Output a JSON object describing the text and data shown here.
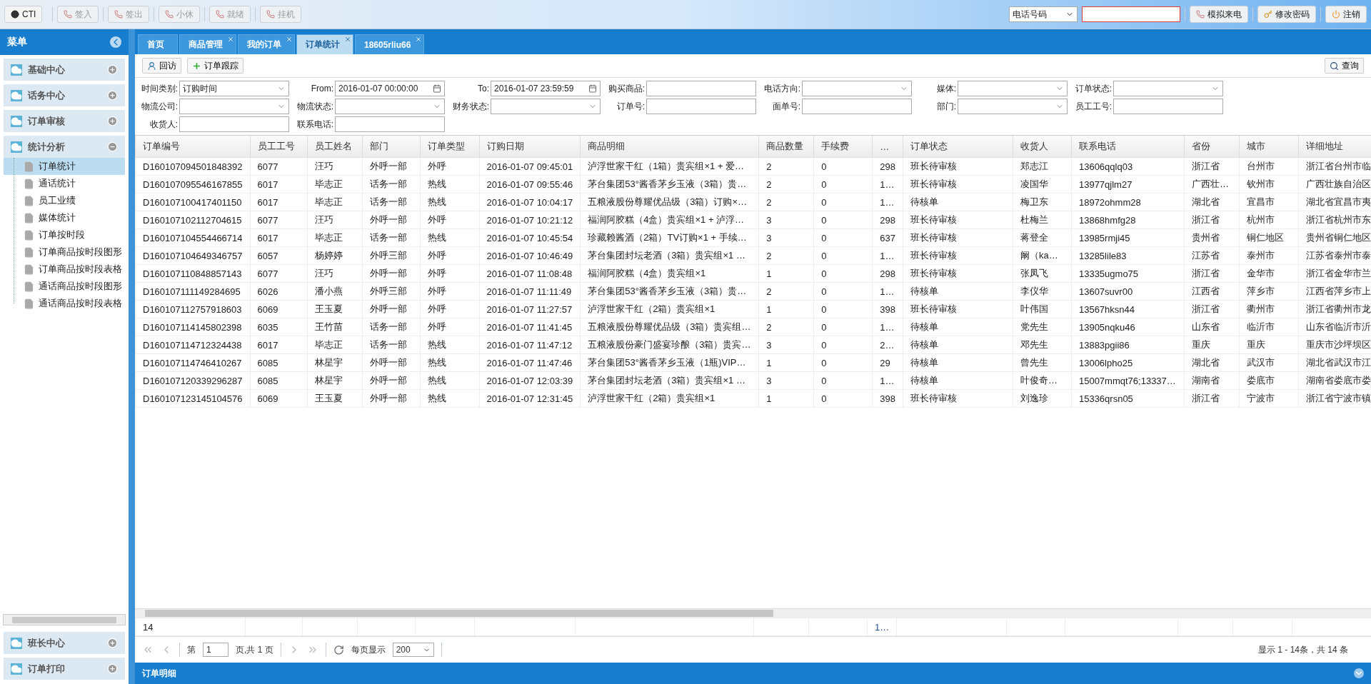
{
  "toolbar": {
    "left_buttons": [
      {
        "label": "CTI",
        "kind": "cti",
        "disabled": false
      },
      {
        "label": "签入",
        "kind": "phone",
        "disabled": true
      },
      {
        "label": "签出",
        "kind": "phone",
        "disabled": true
      },
      {
        "label": "小休",
        "kind": "phone",
        "disabled": true
      },
      {
        "label": "就绪",
        "kind": "phone",
        "disabled": true
      },
      {
        "label": "挂机",
        "kind": "phone",
        "disabled": true
      }
    ],
    "phone_select": {
      "value": "电话号码"
    },
    "right_buttons": [
      {
        "label": "模拟来电",
        "kind": "phone"
      },
      {
        "label": "修改密码",
        "kind": "key"
      },
      {
        "label": "注销",
        "kind": "power"
      }
    ]
  },
  "sidebar": {
    "title": "菜单",
    "sections": [
      {
        "label": "基础中心",
        "expanded": false
      },
      {
        "label": "话务中心",
        "expanded": false
      },
      {
        "label": "订单审核",
        "expanded": false
      },
      {
        "label": "统计分析",
        "expanded": true,
        "children": [
          {
            "label": "订单统计",
            "selected": true
          },
          {
            "label": "通话统计",
            "selected": false
          },
          {
            "label": "员工业绩",
            "selected": false
          },
          {
            "label": "媒体统计",
            "selected": false
          },
          {
            "label": "订单按时段",
            "selected": false
          },
          {
            "label": "订单商品按时段图形",
            "selected": false
          },
          {
            "label": "订单商品按时段表格",
            "selected": false
          },
          {
            "label": "通话商品按时段图形",
            "selected": false
          },
          {
            "label": "通话商品按时段表格",
            "selected": false
          }
        ]
      }
    ],
    "bottom_sections": [
      {
        "label": "班长中心",
        "expanded": false
      },
      {
        "label": "订单打印",
        "expanded": false
      }
    ]
  },
  "tabs": [
    {
      "label": "首页",
      "selected": false,
      "closable": false
    },
    {
      "label": "商品管理",
      "selected": false,
      "closable": true
    },
    {
      "label": "我的订单",
      "selected": false,
      "closable": true
    },
    {
      "label": "订单统计",
      "selected": true,
      "closable": true
    },
    {
      "label": "18605rliu66",
      "selected": false,
      "closable": true
    }
  ],
  "actions": [
    {
      "label": "回访",
      "kind": "user"
    },
    {
      "label": "订单跟踪",
      "kind": "add"
    }
  ],
  "query_button": "查询",
  "filters": [
    [
      {
        "label": "时间类别:",
        "kind": "select",
        "value": "订购时间"
      },
      {
        "label": "From:",
        "kind": "date",
        "value": "2016-01-07 00:00:00"
      },
      {
        "label": "To:",
        "kind": "date",
        "value": "2016-01-07 23:59:59"
      },
      {
        "label": "购买商品:",
        "kind": "input"
      },
      {
        "label": "电话方向:",
        "kind": "select"
      },
      {
        "label": "媒体:",
        "kind": "select"
      },
      {
        "label": "订单状态:",
        "kind": "select"
      }
    ],
    [
      {
        "label": "物流公司:",
        "kind": "select"
      },
      {
        "label": "物流状态:",
        "kind": "select"
      },
      {
        "label": "财务状态:",
        "kind": "select"
      },
      {
        "label": "订单号:",
        "kind": "input"
      },
      {
        "label": "面单号:",
        "kind": "input"
      },
      {
        "label": "部门:",
        "kind": "select"
      },
      {
        "label": "员工工号:",
        "kind": "input"
      }
    ],
    [
      {
        "label": "收货人:",
        "kind": "input"
      },
      {
        "label": "联系电话:",
        "kind": "input"
      }
    ]
  ],
  "table": {
    "columns": [
      "订单编号",
      "员工工号",
      "员工姓名",
      "部门",
      "订单类型",
      "订购日期",
      "商品明细",
      "商品数量",
      "手续费",
      "…",
      "订单状态",
      "收货人",
      "联系电话",
      "省份",
      "城市",
      "详细地址"
    ],
    "rows": [
      [
        "D160107094501848392",
        "6077",
        "汪巧",
        "外呼一部",
        "外呼",
        "2016-01-07 09:45:01",
        "泸浮世家干红（1箱）贵宾组×1 + 爱…",
        "2",
        "0",
        "298",
        "班长待审核",
        "郑志江",
        "13606qqlq03",
        "浙江省",
        "台州市",
        "浙江省台州市临"
      ],
      [
        "D160107095546167855",
        "6017",
        "毕志正",
        "话务一部",
        "热线",
        "2016-01-07 09:55:46",
        "茅台集团53°酱香茅乡玉液（3箱）贵…",
        "2",
        "0",
        "1…",
        "班长待审核",
        "凌国华",
        "13977qjlm27",
        "广西壮…",
        "钦州市",
        "广西壮族自治区"
      ],
      [
        "D160107100417401150",
        "6017",
        "毕志正",
        "话务一部",
        "热线",
        "2016-01-07 10:04:17",
        "五粮液股份尊耀优品级（3箱）订购×…",
        "2",
        "0",
        "1…",
        "待核单",
        "梅卫东",
        "18972ohmm28",
        "湖北省",
        "宜昌市",
        "湖北省宜昌市夷"
      ],
      [
        "D160107102112704615",
        "6077",
        "汪巧",
        "外呼一部",
        "外呼",
        "2016-01-07 10:21:12",
        "福润阿胶糕（4盒）贵宾组×1 + 泸浮…",
        "3",
        "0",
        "298",
        "班长待审核",
        "杜梅兰",
        "13868hmfg28",
        "浙江省",
        "杭州市",
        "浙江省杭州市东"
      ],
      [
        "D160107104554466714",
        "6017",
        "毕志正",
        "话务一部",
        "热线",
        "2016-01-07 10:45:54",
        "珍藏赖酱酒（2箱）TV订购×1 + 手续…",
        "3",
        "0",
        "637",
        "班长待审核",
        "蒋登全",
        "13985rmji45",
        "贵州省",
        "铜仁地区",
        "贵州省铜仁地区"
      ],
      [
        "D160107104649346757",
        "6057",
        "杨婷婷",
        "外呼三部",
        "外呼",
        "2016-01-07 10:46:49",
        "茅台集团封坛老酒（3箱）贵宾组×1 …",
        "2",
        "0",
        "1…",
        "班长待审核",
        "阚（ka…",
        "13285lile83",
        "江苏省",
        "泰州市",
        "江苏省泰州市泰"
      ],
      [
        "D160107110848857143",
        "6077",
        "汪巧",
        "外呼一部",
        "外呼",
        "2016-01-07 11:08:48",
        "福润阿胶糕（4盒）贵宾组×1",
        "1",
        "0",
        "298",
        "班长待审核",
        "张凤飞",
        "13335ugmo75",
        "浙江省",
        "金华市",
        "浙江省金华市兰"
      ],
      [
        "D160107111149284695",
        "6026",
        "潘小燕",
        "外呼三部",
        "外呼",
        "2016-01-07 11:11:49",
        "茅台集团53°酱香茅乡玉液（3箱）贵…",
        "2",
        "0",
        "1…",
        "待核单",
        "李仪华",
        "13607suvr00",
        "江西省",
        "萍乡市",
        "江西省萍乡市上"
      ],
      [
        "D160107112757918603",
        "6069",
        "王玉夏",
        "外呼一部",
        "外呼",
        "2016-01-07 11:27:57",
        "泸浮世家干红（2箱）贵宾组×1",
        "1",
        "0",
        "398",
        "班长待审核",
        "叶伟国",
        "13567hksn44",
        "浙江省",
        "衢州市",
        "浙江省衢州市龙"
      ],
      [
        "D160107114145802398",
        "6035",
        "王竹苗",
        "话务一部",
        "外呼",
        "2016-01-07 11:41:45",
        "五粮液股份尊耀优品级（3箱）贵宾组…",
        "2",
        "0",
        "1…",
        "待核单",
        "党先生",
        "13905nqku46",
        "山东省",
        "临沂市",
        "山东省临沂市沂"
      ],
      [
        "D160107114712324438",
        "6017",
        "毕志正",
        "话务一部",
        "热线",
        "2016-01-07 11:47:12",
        "五粮液股份豪门盛宴珍酿（3箱）贵宾…",
        "3",
        "0",
        "2…",
        "待核单",
        "邓先生",
        "13883pgii86",
        "重庆",
        "重庆",
        "重庆市沙坪坝区"
      ],
      [
        "D160107114746410267",
        "6085",
        "林星宇",
        "外呼一部",
        "热线",
        "2016-01-07 11:47:46",
        "茅台集团53°酱香茅乡玉液（1瓶)VIP…",
        "1",
        "0",
        "29",
        "待核单",
        "曾先生",
        "13006lpho25",
        "湖北省",
        "武汉市",
        "湖北省武汉市江"
      ],
      [
        "D160107120339296287",
        "6085",
        "林星宇",
        "外呼一部",
        "热线",
        "2016-01-07 12:03:39",
        "茅台集团封坛老酒（3箱）贵宾组×1 …",
        "3",
        "0",
        "1…",
        "待核单",
        "叶俊奇…",
        "15007mmqt76;13337…",
        "湖南省",
        "娄底市",
        "湖南省娄底市娄"
      ],
      [
        "D160107123145104576",
        "6069",
        "王玉夏",
        "外呼一部",
        "热线",
        "2016-01-07 12:31:45",
        "泸浮世家干红（2箱）贵宾组×1",
        "1",
        "0",
        "398",
        "班长待审核",
        "刘逸珍",
        "15336qrsn05",
        "浙江省",
        "宁波市",
        "浙江省宁波市镇"
      ]
    ],
    "footer": {
      "row_count": "14",
      "column_10_total": "1…"
    }
  },
  "pager": {
    "page_label": "第",
    "page": "1",
    "page_total": "页,共 1 页",
    "per_page_label": "每页显示",
    "per_page": "200",
    "summary": "显示 1 - 14条，共 14 条"
  },
  "bottom_panel": {
    "title": "订单明细"
  }
}
